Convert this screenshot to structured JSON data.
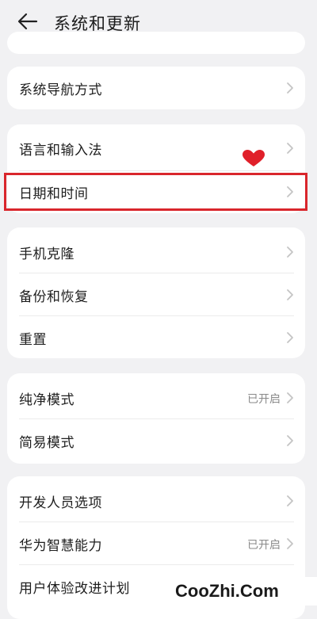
{
  "header": {
    "back_icon": "arrow-left-icon",
    "title": "系统和更新"
  },
  "groups": [
    {
      "items": [
        {
          "label": "系统导航方式"
        }
      ]
    },
    {
      "items": [
        {
          "label": "语言和输入法"
        },
        {
          "label": "日期和时间"
        }
      ]
    },
    {
      "items": [
        {
          "label": "手机克隆"
        },
        {
          "label": "备份和恢复"
        },
        {
          "label": "重置"
        }
      ]
    },
    {
      "items": [
        {
          "label": "纯净模式",
          "status": "已开启"
        },
        {
          "label": "简易模式"
        }
      ]
    },
    {
      "items": [
        {
          "label": "开发人员选项"
        },
        {
          "label": "华为智慧能力",
          "status": "已开启"
        },
        {
          "label": "用户体验改进计划"
        }
      ]
    }
  ],
  "annotation": {
    "highlight_color": "#d9262c",
    "decoration": "heart-icon"
  },
  "watermark": {
    "text": "CooZhi.Com"
  }
}
